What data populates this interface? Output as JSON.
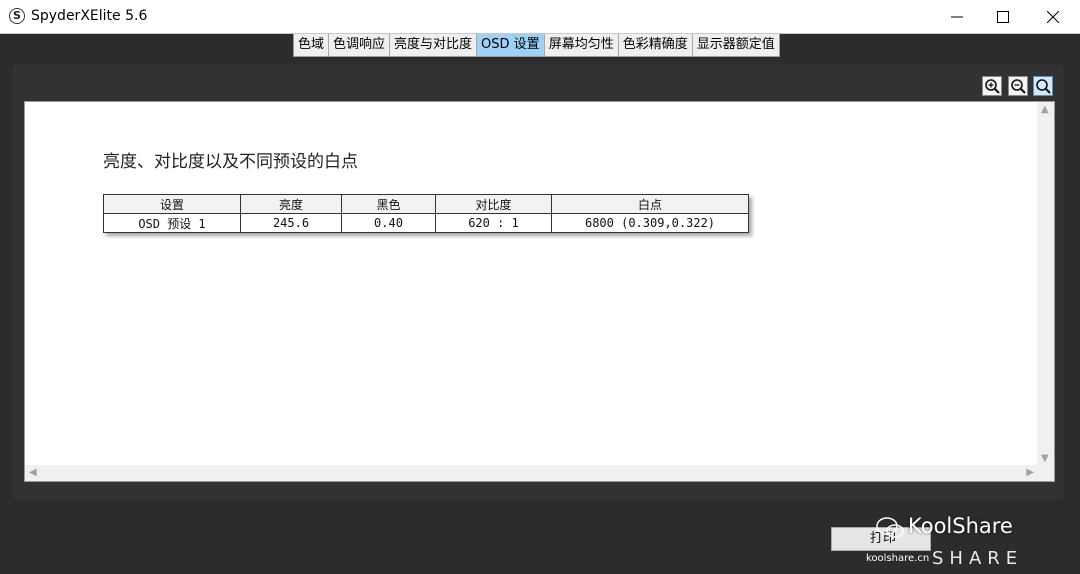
{
  "window": {
    "title": "SpyderXElite 5.6",
    "icon_letter": "S"
  },
  "tabs": [
    {
      "label": "色域"
    },
    {
      "label": "色调响应"
    },
    {
      "label": "亮度与对比度"
    },
    {
      "label": "OSD 设置",
      "active": true
    },
    {
      "label": "屏幕均匀性"
    },
    {
      "label": "色彩精确度"
    },
    {
      "label": "显示器额定值"
    }
  ],
  "report": {
    "title": "亮度、对比度以及不同预设的白点",
    "columns": [
      "设置",
      "亮度",
      "黑色",
      "对比度",
      "白点"
    ],
    "rows": [
      [
        "OSD 预设 1",
        "245.6",
        "0.40",
        "620 : 1",
        "6800 (0.309,0.322)"
      ]
    ]
  },
  "bottom_button": {
    "label": "打印"
  },
  "watermark": {
    "brand": "KoolShare",
    "url": "koolshare.cn",
    "share": "SHARE"
  },
  "colors": {
    "active_tab": "#9fd0f5",
    "background": "#2c2c2c"
  }
}
